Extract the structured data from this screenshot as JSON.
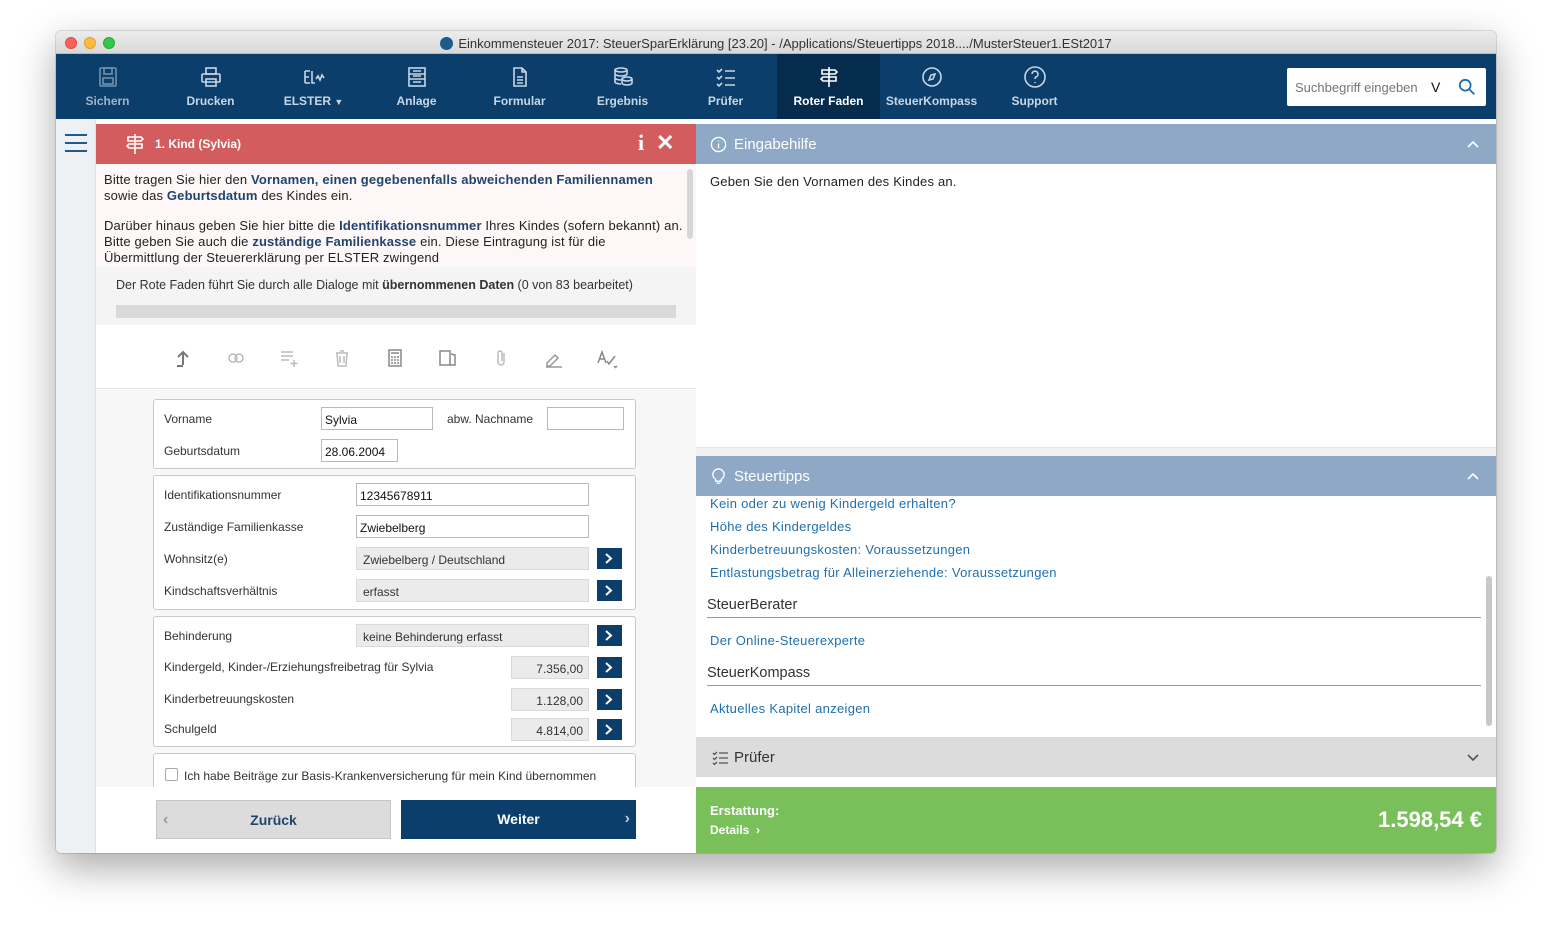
{
  "window": {
    "title": "Einkommensteuer 2017: SteuerSparErklärung [23.20] - /Applications/Steuertipps 2018..../MusterSteuer1.ESt2017"
  },
  "toolbar": {
    "items": [
      {
        "label": "Sichern",
        "icon": "save-icon"
      },
      {
        "label": "Drucken",
        "icon": "printer-icon"
      },
      {
        "label": "ELSTER",
        "icon": "elster-icon"
      },
      {
        "label": "Anlage",
        "icon": "form-sheet-icon"
      },
      {
        "label": "Formular",
        "icon": "document-icon"
      },
      {
        "label": "Ergebnis",
        "icon": "coins-icon"
      },
      {
        "label": "Prüfer",
        "icon": "checklist-icon"
      },
      {
        "label": "Roter Faden",
        "icon": "signpost-icon"
      },
      {
        "label": "SteuerKompass",
        "icon": "compass-icon"
      },
      {
        "label": "Support",
        "icon": "help-icon"
      }
    ],
    "active": "Roter Faden",
    "search": {
      "placeholder": "Suchbegriff eingeben",
      "suffix": "V"
    }
  },
  "left": {
    "header_title": "1. Kind (Sylvia)",
    "intro": {
      "p1_a": "Bitte tragen Sie hier den ",
      "p1_b": "Vornamen, einen gegebenenfalls abweichenden Familiennamen",
      "p1_c": " sowie das ",
      "p1_d": "Geburtsdatum",
      "p1_e": " des Kindes ein.",
      "p2_a": "Darüber hinaus geben Sie hier bitte die ",
      "p2_b": "Identifikationsnummer",
      "p2_c": " Ihres Kindes (sofern bekannt) an. Bitte geben Sie auch die ",
      "p2_d": "zuständige Familienkasse",
      "p2_e": " ein. Diese Eintragung ist für die Übermittlung der Steuererklärung per ELSTER zwingend"
    },
    "roter_faden": {
      "text_a": "Der Rote Faden führt Sie durch alle Dialoge mit ",
      "text_b": "übernommenen Daten",
      "text_c": " (0 von 83 bearbeitet)",
      "progress": 0
    },
    "form": {
      "vorname_label": "Vorname",
      "vorname": "Sylvia",
      "abw_nachname_label": "abw. Nachname",
      "abw_nachname": "",
      "geburtsdatum_label": "Geburtsdatum",
      "geburtsdatum": "28.06.2004",
      "idnr_label": "Identifikationsnummer",
      "idnr": "12345678911",
      "familienkasse_label": "Zuständige Familienkasse",
      "familienkasse": "Zwiebelberg",
      "wohnsitz_label": "Wohnsitz(e)",
      "wohnsitz": "Zwiebelberg / Deutschland",
      "kindschaft_label": "Kindschaftsverhältnis",
      "kindschaft": "erfasst",
      "behinderung_label": "Behinderung",
      "behinderung": "keine Behinderung erfasst",
      "kindergeld_label": "Kindergeld, Kinder-/Erziehungsfreibetrag für Sylvia",
      "kindergeld": "7.356,00",
      "betreuung_label": "Kinderbetreuungskosten",
      "betreuung": "1.128,00",
      "schulgeld_label": "Schulgeld",
      "schulgeld": "4.814,00",
      "kv_checkbox_label": "Ich habe Beiträge zur Basis-Krankenversicherung für mein Kind übernommen"
    },
    "nav": {
      "back": "Zurück",
      "next": "Weiter"
    }
  },
  "right": {
    "eingabehilfe": {
      "title": "Eingabehilfe",
      "text": "Geben Sie den Vornamen des Kindes an."
    },
    "steuertipps": {
      "title": "Steuertipps",
      "links": [
        "Kein oder zu wenig Kindergeld erhalten?",
        "Höhe des Kindergeldes",
        "Kinderbetreuungskosten: Voraussetzungen",
        "Entlastungsbetrag für Alleinerziehende: Voraussetzungen"
      ],
      "berater_title": "SteuerBerater",
      "berater_link": "Der Online-Steuerexperte",
      "kompass_title": "SteuerKompass",
      "kompass_link": "Aktuelles Kapitel anzeigen"
    },
    "pruefer": {
      "title": "Prüfer"
    },
    "refund": {
      "label": "Erstattung:",
      "details": "Details",
      "amount": "1.598,54 €"
    }
  },
  "colors": {
    "toolbar": "#0b3e6a",
    "header_red": "#d35d5e",
    "section_blue": "#8fa8c5",
    "refund_green": "#7ac05a",
    "link": "#1f6fae"
  }
}
